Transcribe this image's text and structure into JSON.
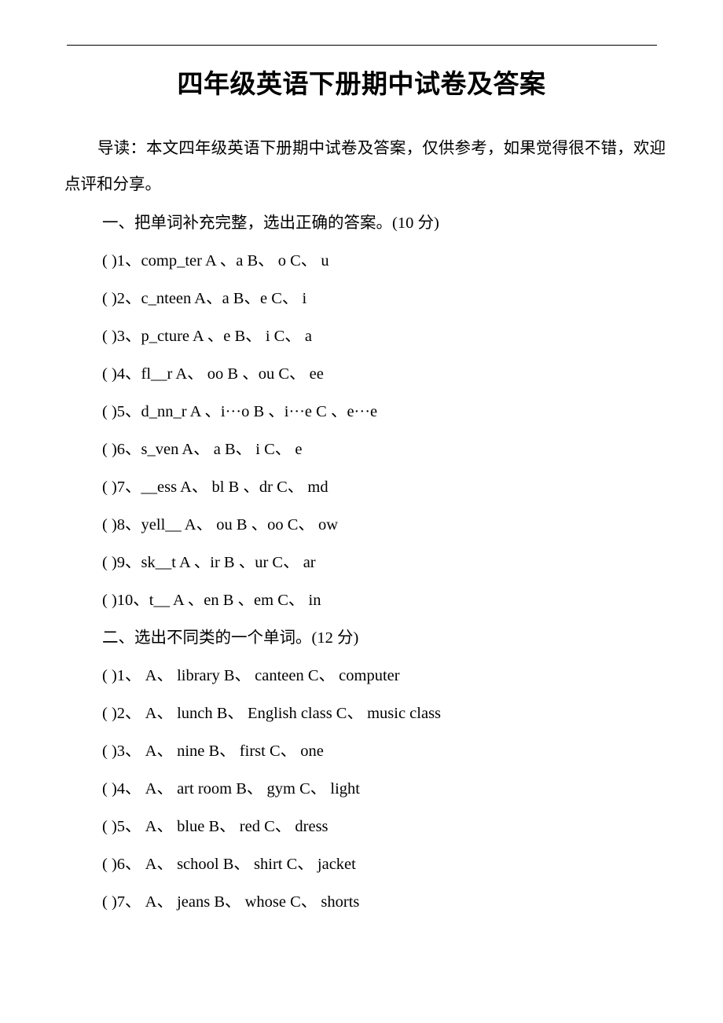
{
  "document": {
    "title": "四年级英语下册期中试卷及答案",
    "intro": "导读：本文四年级英语下册期中试卷及答案，仅供参考，如果觉得很不错，欢迎点评和分享。",
    "sections": [
      {
        "heading": "一、把单词补充完整，选出正确的答案。(10 分)",
        "items": [
          "( )1、comp_ter A 、a B、  o C、  u",
          "( )2、c_nteen A、a B、e C、  i",
          "( )3、p_cture A 、e B、  i C、  a",
          "( )4、fl__r A、  oo B 、ou C、  ee",
          "( )5、d_nn_r A 、i···o B 、i···e C 、e···e",
          "( )6、s_ven A、  a B、  i C、  e",
          "( )7、__ess A、  bl B 、dr C、  md",
          "( )8、yell__ A、  ou B 、oo C、  ow",
          "( )9、sk__t A 、ir B 、ur C、  ar",
          "( )10、t__ A 、en B 、em C、  in"
        ]
      },
      {
        "heading": "二、选出不同类的一个单词。(12 分)",
        "items": [
          "( )1、  A、  library B、  canteen C、  computer",
          "( )2、  A、  lunch B、  English class C、  music class",
          "( )3、  A、  nine B、  first C、  one",
          "( )4、  A、  art room B、  gym C、  light",
          "( )5、  A、  blue B、  red C、  dress",
          "( )6、  A、  school B、  shirt C、  jacket",
          "( )7、  A、  jeans B、  whose C、  shorts"
        ]
      }
    ]
  }
}
